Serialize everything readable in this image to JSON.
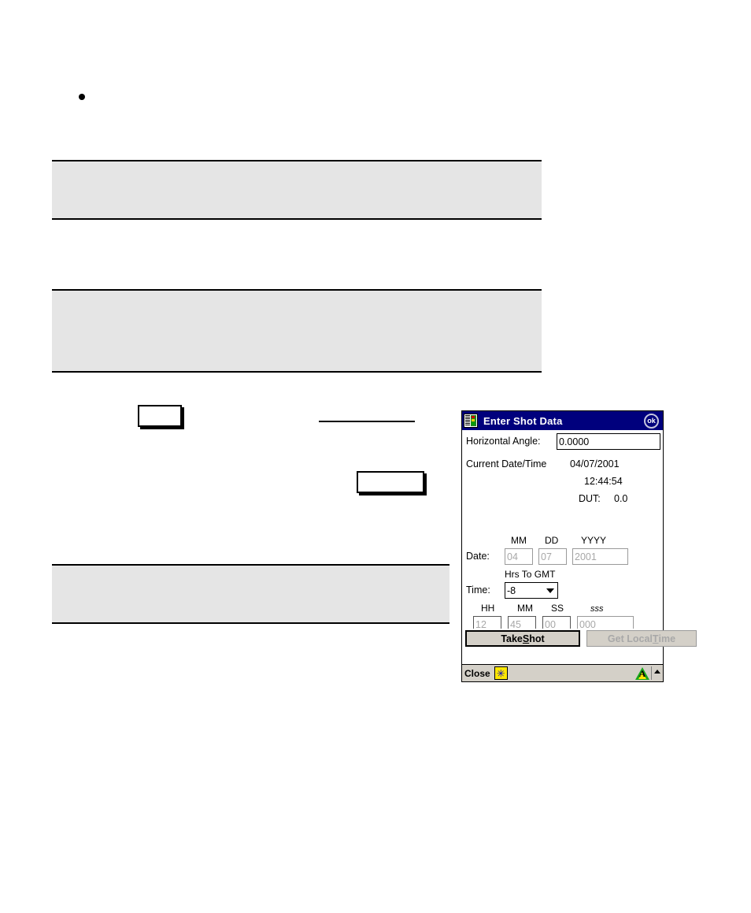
{
  "document": {
    "bullet_present": true,
    "shaded_blocks": 3,
    "empty_boxes": 2,
    "rules": 1
  },
  "dialog": {
    "title": "Enter Shot Data",
    "title_icon": "traffic-light-book-icon",
    "ok_label": "ok",
    "horizontal_angle": {
      "label": "Horizontal Angle:",
      "value": "0.0000"
    },
    "current": {
      "label": "Current Date/Time",
      "date": "04/07/2001",
      "time": "12:44:54",
      "dut_label": "DUT:",
      "dut_value": "0.0"
    },
    "date_row": {
      "label": "Date:",
      "mm_header": "MM",
      "dd_header": "DD",
      "yyyy_header": "YYYY",
      "mm_value": "04",
      "dd_value": "07",
      "yyyy_value": "2001"
    },
    "time_row": {
      "label": "Time:",
      "gmt_header": "Hrs To GMT",
      "gmt_value": "-8",
      "hh_header": "HH",
      "mm_header": "MM",
      "ss_header": "SS",
      "sss_header": "sss",
      "hh_value": "12",
      "mm_value": "45",
      "ss_value": "00",
      "sss_value": "000"
    },
    "buttons": {
      "take_shot_pre": "Take ",
      "take_shot_accel": "S",
      "take_shot_post": "hot",
      "get_local_pre": "Get Local ",
      "get_local_accel": "T",
      "get_local_post": "ime"
    },
    "taskbar": {
      "close_label": "Close",
      "input_panel_icon": "asterisk-icon",
      "asterisk_glyph": "✳",
      "tray_icon": "alert-triangle-icon",
      "tray_letter": "A",
      "up_arrow_icon": "chevron-up-icon"
    },
    "colors": {
      "titlebar": "#00007d",
      "taskbar": "#d4d0c8",
      "shade": "#e5e5e5"
    }
  }
}
